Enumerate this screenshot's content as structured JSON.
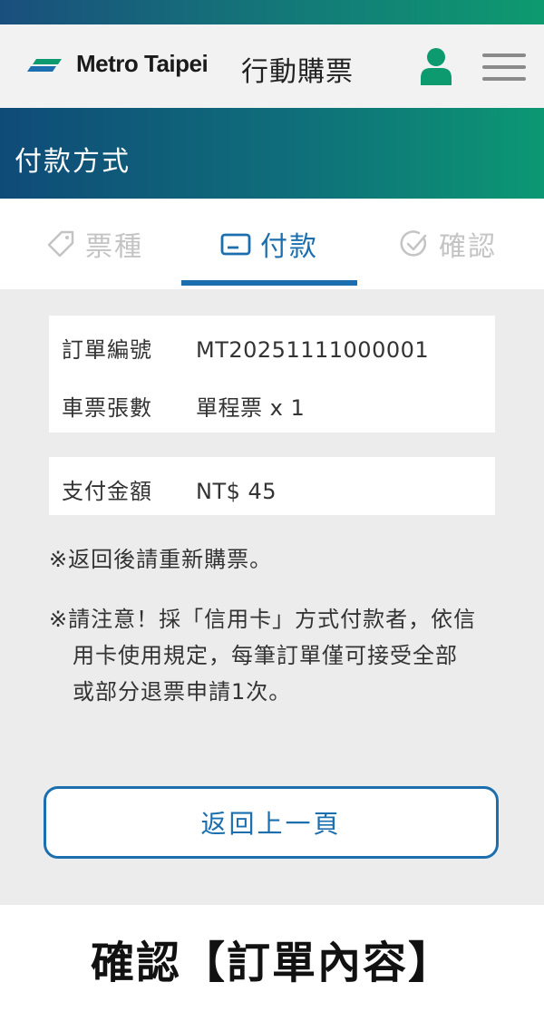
{
  "header": {
    "brand": "Metro Taipei",
    "app_title": "行動購票"
  },
  "page": {
    "title": "付款方式"
  },
  "steps": [
    {
      "label": "票種",
      "icon": "ticket-icon",
      "state": "inactive"
    },
    {
      "label": "付款",
      "icon": "card-icon",
      "state": "active"
    },
    {
      "label": "確認",
      "icon": "check-circle-icon",
      "state": "inactive"
    }
  ],
  "order": {
    "order_no_label": "訂單編號",
    "order_no": "MT20251111000001",
    "ticket_count_label": "車票張數",
    "ticket_count": "單程票 x 1",
    "amount_label": "支付金額",
    "amount": "NT$ 45"
  },
  "notes": {
    "note1": "※返回後請重新購票。",
    "note2_line1": "※請注意！採「信用卡」方式付款者，依信",
    "note2_line2": "用卡使用規定，每筆訂單僅可接受全部",
    "note2_line3": "或部分退票申請1次。"
  },
  "back_button": "返回上一頁",
  "caption": "確認【訂單內容】",
  "colors": {
    "accent": "#1b6fae",
    "banner_start": "#0f4b78",
    "banner_end": "#0c9873",
    "user_icon": "#0e9a6f",
    "content_bg": "#ececec"
  }
}
